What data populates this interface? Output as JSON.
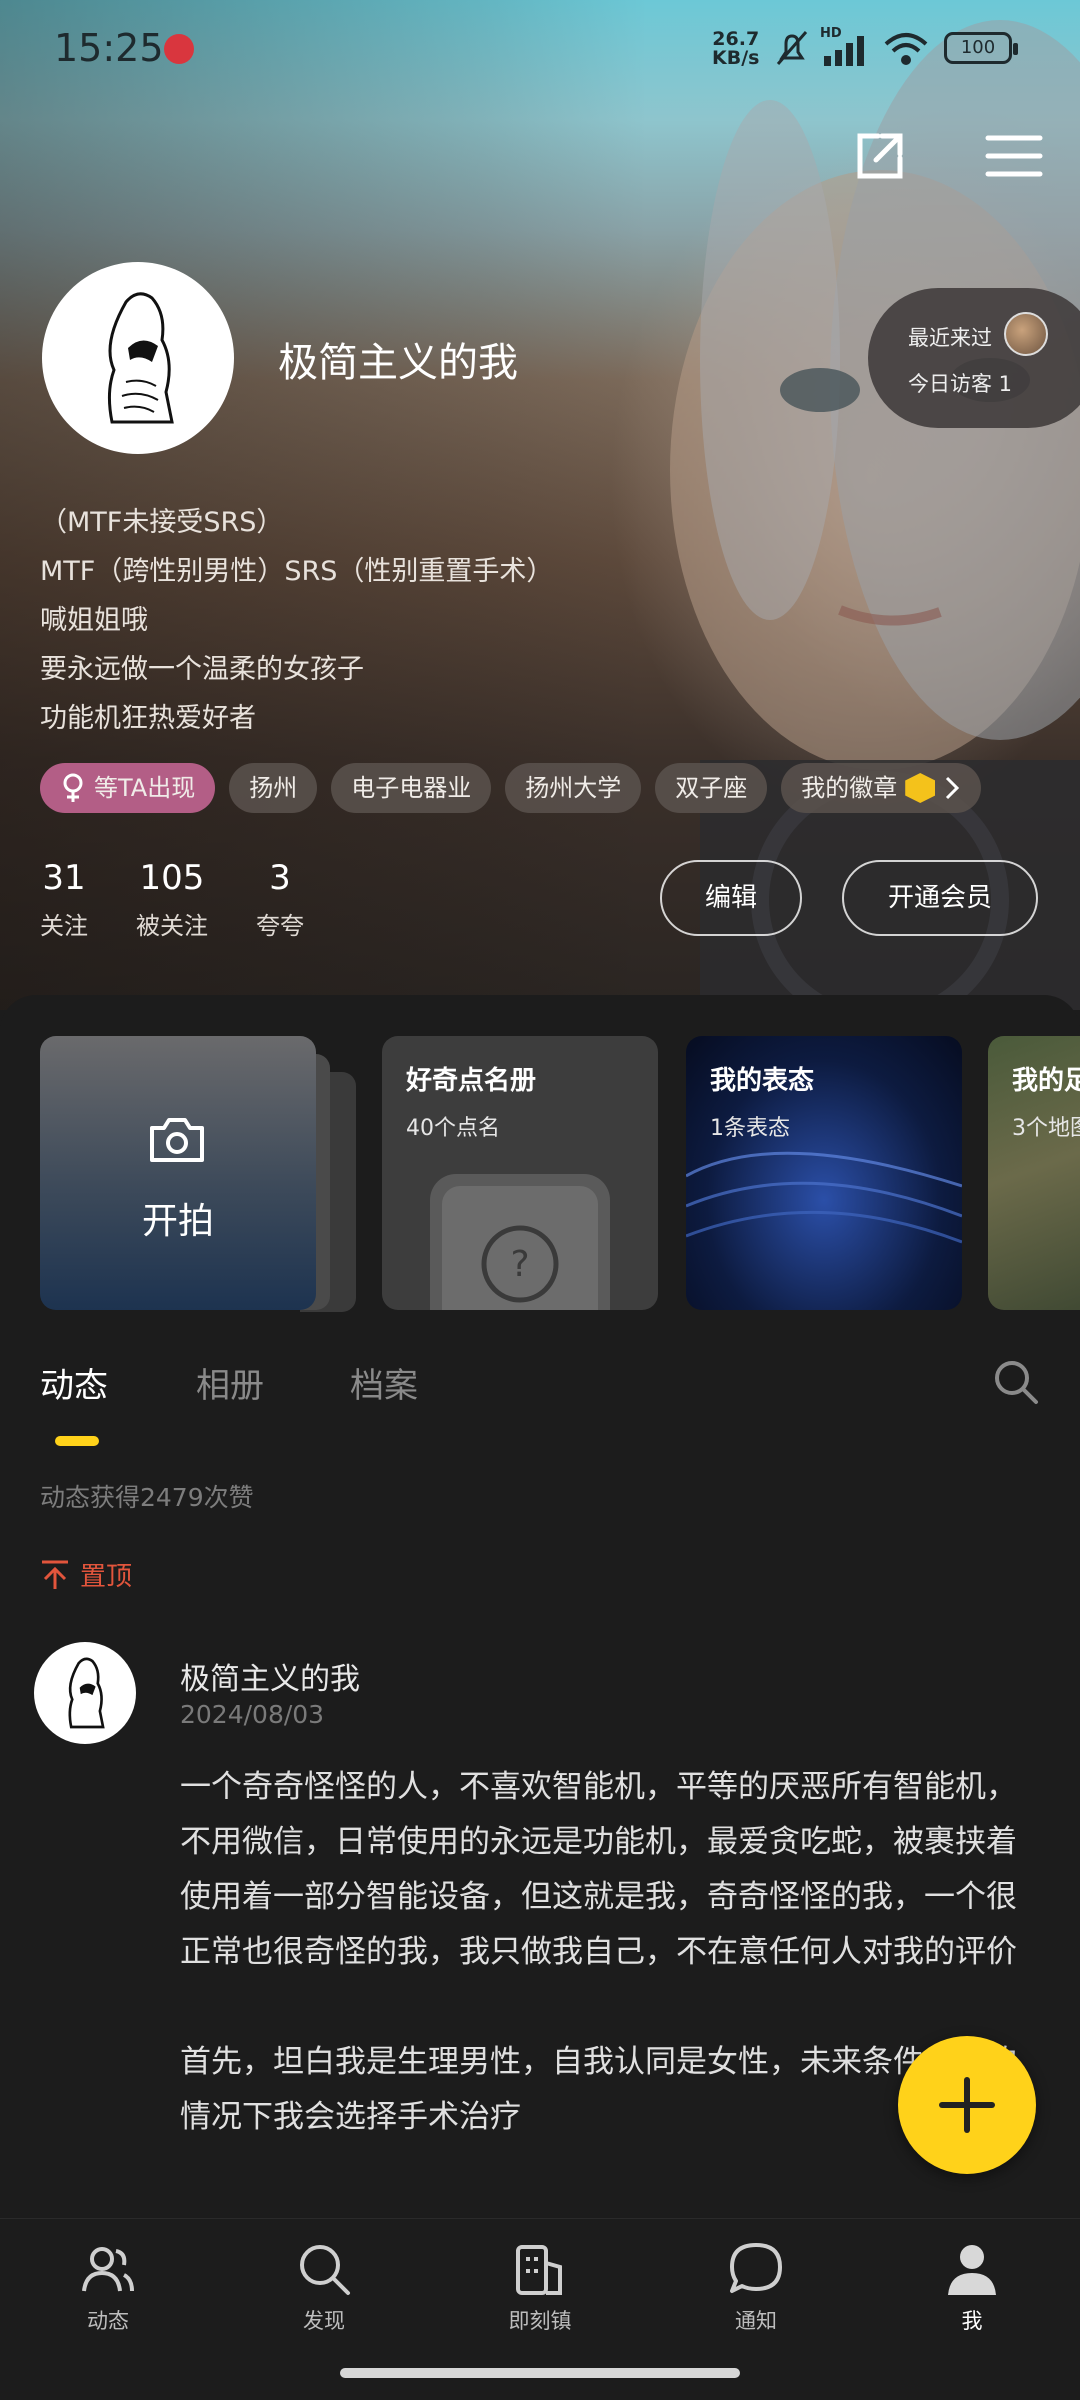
{
  "status_bar": {
    "time": "15:25",
    "net_speed_value": "26.7",
    "net_speed_unit": "KB/s",
    "battery": "100",
    "network_label": "HD"
  },
  "profile": {
    "nickname": "极简主义的我",
    "bio": [
      "（MTF未接受SRS）",
      "MTF（跨性别男性）SRS（性别重置手术）",
      "喊姐姐哦",
      "要永远做一个温柔的女孩子",
      "功能机狂热爱好者"
    ],
    "tags": [
      "等TA出现",
      "扬州",
      "电子电器业",
      "扬州大学",
      "双子座",
      "我的徽章"
    ],
    "stats": [
      {
        "num": "31",
        "label": "关注"
      },
      {
        "num": "105",
        "label": "被关注"
      },
      {
        "num": "3",
        "label": "夸夸"
      }
    ],
    "edit_label": "编辑",
    "vip_label": "开通会员"
  },
  "visitors": {
    "recent_label": "最近来过",
    "today_label": "今日访客 1"
  },
  "cards": [
    {
      "title": "开拍",
      "subtitle": ""
    },
    {
      "title": "好奇点名册",
      "subtitle": "40个点名"
    },
    {
      "title": "我的表态",
      "subtitle": "1条表态"
    },
    {
      "title": "我的足",
      "subtitle": "3个地图"
    }
  ],
  "tabs": [
    "动态",
    "相册",
    "档案"
  ],
  "feed": {
    "likes_text": "动态获得2479次赞",
    "pinned_label": "置顶",
    "post": {
      "author": "极简主义的我",
      "date": "2024/08/03",
      "paragraphs": [
        "一个奇奇怪怪的人，不喜欢智能机，平等的厌恶所有智能机，不用微信，日常使用的永远是功能机，最爱贪吃蛇，被裹挟着使用着一部分智能设备，但这就是我，奇奇怪怪的我，一个很正常也很奇怪的我，我只做我自己，不在意任何人对我的评价",
        "首先，坦白我是生理男性，自我认同是女性，未来条件允许的情况下我会选择手术治疗"
      ]
    }
  },
  "bottom_nav": [
    "动态",
    "发现",
    "即刻镇",
    "通知",
    "我"
  ],
  "colors": {
    "accent_yellow": "#ffd21a",
    "pinned_red": "#e2553c",
    "tag_pink": "#b35e86",
    "panel_bg": "#1c1c1c"
  }
}
